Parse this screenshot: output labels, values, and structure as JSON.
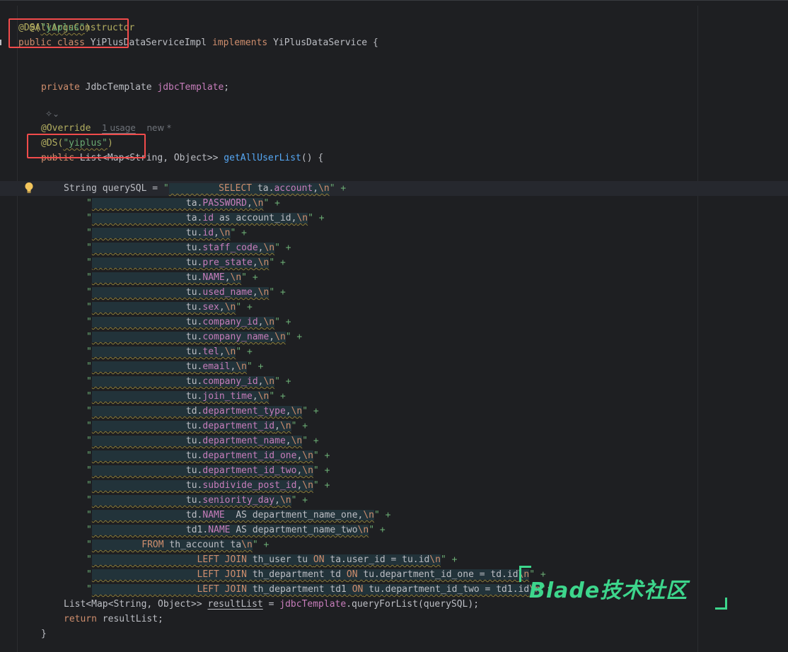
{
  "header_annotation": "@AllArgsConstructor",
  "class_ds": {
    "ann": "@DS(",
    "str": "\"yiplus\"",
    "close": ")"
  },
  "class_decl": {
    "public": "public",
    "class_kw": "class",
    "name": "YiPlusDataServiceImpl",
    "implements": "implements",
    "iface": "YiPlusDataService",
    "brace": "{"
  },
  "field": {
    "private": "private",
    "type": "JdbcTemplate",
    "name": "jdbcTemplate",
    "semi": ";"
  },
  "override": {
    "ann": "@Override",
    "usage": "1 usage",
    "new": "new *"
  },
  "method_ds": {
    "ann": "@DS(",
    "str": "\"yiplus\"",
    "close": ")"
  },
  "method_decl": {
    "public": "public",
    "return_type": "List<Map<String, Object>>",
    "name": "getAllUserList",
    "rest": "() {"
  },
  "query_start": {
    "prefix": "String querySQL = ",
    "quote": "\"",
    "pad": "         ",
    "select": "SELECT",
    "sp": " ",
    "tbl": "ta",
    "dot": ".",
    "col": "account",
    "comma": ",",
    "esc": "\\n",
    "end": "\" +"
  },
  "sql_lines": [
    {
      "pad": "                 ",
      "t": "ta",
      "c": "PASSWORD",
      "suffix": ","
    },
    {
      "pad": "                 ",
      "t": "ta",
      "c": "id",
      "suffix": " as account_id,"
    },
    {
      "pad": "                 ",
      "t": "tu",
      "c": "id",
      "suffix": ","
    },
    {
      "pad": "                 ",
      "t": "tu",
      "c": "staff_code",
      "suffix": ","
    },
    {
      "pad": "                 ",
      "t": "tu",
      "c": "pre_state",
      "suffix": ","
    },
    {
      "pad": "                 ",
      "t": "tu",
      "c": "NAME",
      "suffix": ","
    },
    {
      "pad": "                 ",
      "t": "tu",
      "c": "used_name",
      "suffix": ","
    },
    {
      "pad": "                 ",
      "t": "tu",
      "c": "sex",
      "suffix": ","
    },
    {
      "pad": "                 ",
      "t": "tu",
      "c": "company_id",
      "suffix": ","
    },
    {
      "pad": "                 ",
      "t": "tu",
      "c": "company_name",
      "suffix": ","
    },
    {
      "pad": "                 ",
      "t": "tu",
      "c": "tel",
      "suffix": ","
    },
    {
      "pad": "                 ",
      "t": "tu",
      "c": "email",
      "suffix": ","
    },
    {
      "pad": "                 ",
      "t": "tu",
      "c": "company_id",
      "suffix": ","
    },
    {
      "pad": "                 ",
      "t": "tu",
      "c": "join_time",
      "suffix": ","
    },
    {
      "pad": "                 ",
      "t": "td",
      "c": "department_type",
      "suffix": ","
    },
    {
      "pad": "                 ",
      "t": "tu",
      "c": "department_id",
      "suffix": ","
    },
    {
      "pad": "                 ",
      "t": "tu",
      "c": "department_name",
      "suffix": ","
    },
    {
      "pad": "                 ",
      "t": "tu",
      "c": "department_id_one",
      "suffix": ","
    },
    {
      "pad": "                 ",
      "t": "tu",
      "c": "department_id_two",
      "suffix": ","
    },
    {
      "pad": "                 ",
      "t": "tu",
      "c": "subdivide_post_id",
      "suffix": ","
    },
    {
      "pad": "                 ",
      "t": "tu",
      "c": "seniority_day",
      "suffix": ","
    },
    {
      "pad": "                 ",
      "t": "td",
      "c": "NAME",
      "suffix": "  AS department_name_one,"
    },
    {
      "pad": "                 ",
      "t": "td1",
      "c": "NAME",
      "suffix": " AS department_name_two"
    }
  ],
  "from_line": {
    "pad": "         ",
    "kw": "FROM",
    "rest": " th_account ta"
  },
  "join_lines": [
    {
      "pad": "                   ",
      "kw": "LEFT JOIN",
      "rest1": " th_user tu ",
      "on": "ON",
      "rest2": " ta.user_id = tu.id",
      "end": "\" +"
    },
    {
      "pad": "                   ",
      "kw": "LEFT JOIN",
      "rest1": " th_department td ",
      "on": "ON",
      "rest2": " tu.department_id_one = td.id",
      "end": "\" +"
    },
    {
      "pad": "                   ",
      "kw": "LEFT JOIN",
      "rest1": " th_department td1 ",
      "on": "ON",
      "rest2": " tu.department_id_two = td1.id",
      "end": "\";"
    }
  ],
  "result_line": {
    "type": "List<Map<String, Object>> ",
    "var": "resultList",
    "eq": " = ",
    "obj": "jdbcTemplate",
    "dot": ".",
    "call": "queryForList",
    "args": "(querySQL);"
  },
  "return_line": {
    "kw": "return",
    "rest": " resultList;"
  },
  "close_brace": "}",
  "sym": {
    "quote": "\"",
    "esc": "\\n",
    "plus": "\" +",
    "dot": "."
  },
  "icons": {
    "bulb": "lightbulb-icon",
    "ai": "ai-assistant-icon"
  },
  "watermark": {
    "text": "Blade技术社区",
    "color": "#3dd68c"
  },
  "colors": {
    "background": "#1e1f22",
    "highlight_box": "#f24b4b"
  }
}
